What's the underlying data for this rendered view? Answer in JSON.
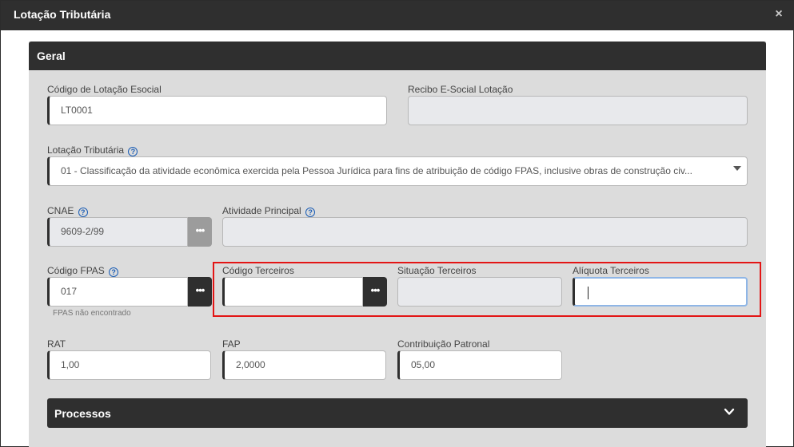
{
  "modal": {
    "title": "Lotação Tributária",
    "close_glyph": "×"
  },
  "panel": {
    "title": "Geral"
  },
  "fields": {
    "codigo_lotacao": {
      "label": "Código de Lotação Esocial",
      "value": "LT0001"
    },
    "recibo": {
      "label": "Recibo E-Social Lotação",
      "value": ""
    },
    "lotacao_tributaria": {
      "label": "Lotação Tributária",
      "value": "01 - Classificação da atividade econômica exercida pela Pessoa Jurídica para fins de atribuição de código FPAS, inclusive obras de construção civ..."
    },
    "cnae": {
      "label": "CNAE",
      "value": "9609-2/99"
    },
    "atividade_principal": {
      "label": "Atividade Principal",
      "value": ""
    },
    "codigo_fpas": {
      "label": "Código FPAS",
      "value": "017",
      "hint": "FPAS não encontrado"
    },
    "codigo_terceiros": {
      "label": "Código Terceiros",
      "value": ""
    },
    "situacao_terceiros": {
      "label": "Situação Terceiros",
      "value": ""
    },
    "aliquota_terceiros": {
      "label": "Alíquota Terceiros",
      "value": ""
    },
    "rat": {
      "label": "RAT",
      "value": "1,00"
    },
    "fap": {
      "label": "FAP",
      "value": "2,0000"
    },
    "contribuicao_patronal": {
      "label": "Contribuição Patronal",
      "value": "05,00"
    }
  },
  "ui": {
    "help_glyph": "?",
    "dots_glyph": "•••"
  },
  "accordion": {
    "title": "Processos"
  },
  "colors": {
    "header": "#2f2f2f",
    "panel_bg": "#dcdcdc",
    "highlight": "#e31515",
    "help": "#1a5db5"
  }
}
